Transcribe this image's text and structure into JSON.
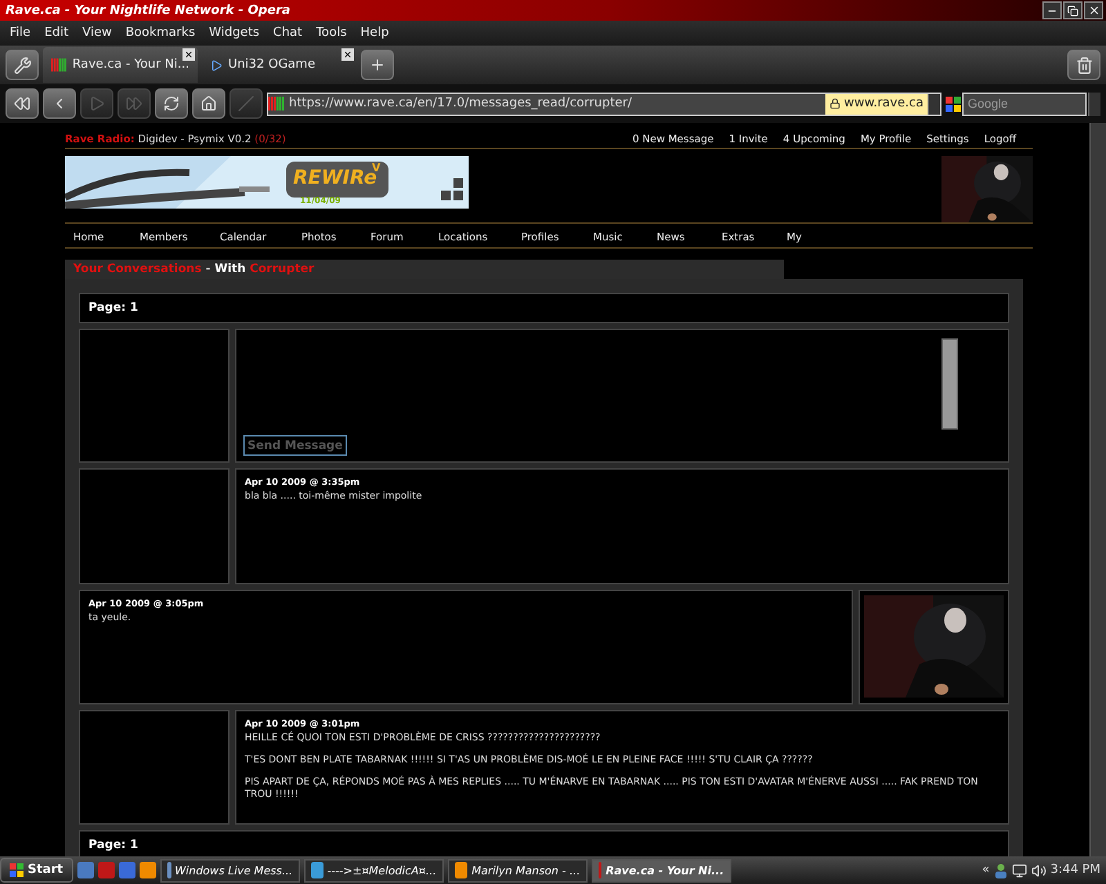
{
  "window": {
    "title": "Rave.ca - Your Nightlife Network - Opera"
  },
  "menu": [
    "File",
    "Edit",
    "View",
    "Bookmarks",
    "Widgets",
    "Chat",
    "Tools",
    "Help"
  ],
  "tabs": [
    {
      "label": "Rave.ca - Your Ni...",
      "selected": true
    },
    {
      "label": "Uni32 OGame",
      "selected": false
    }
  ],
  "nav_buttons": [
    {
      "kind": "rewind",
      "disabled": false
    },
    {
      "kind": "back",
      "disabled": false
    },
    {
      "kind": "forward",
      "disabled": true
    },
    {
      "kind": "fast_forward",
      "disabled": true
    },
    {
      "kind": "reload",
      "disabled": false
    },
    {
      "kind": "home",
      "disabled": false
    },
    {
      "kind": "edit",
      "disabled": true
    }
  ],
  "address": {
    "value": "https://www.rave.ca/en/17.0/messages_read/corrupter/",
    "site": "www.rave.ca"
  },
  "search": {
    "placeholder": "Google"
  },
  "page": {
    "radio": {
      "label": "Rave Radio:",
      "track": "Digidev - Psymix V0.2",
      "count": "(0/32)"
    },
    "user_links": [
      "0 New Message",
      "1 Invite",
      "4 Upcoming",
      "My Profile",
      "Settings",
      "Logoff"
    ],
    "banner": {
      "title": "REWIRe",
      "mark": "V",
      "date": "11/04/09"
    },
    "nav": [
      "Home",
      "Members",
      "Calendar",
      "Photos",
      "Forum",
      "Locations",
      "Profiles",
      "Music",
      "News",
      "Extras",
      "My"
    ],
    "heading": [
      {
        "text": "Your Conversations",
        "color": "#e01010"
      },
      {
        "text": "-",
        "color": "#cccccc"
      },
      {
        "text": "With",
        "color": "#ffffff"
      },
      {
        "text": "Corrupter",
        "color": "#e01010"
      }
    ],
    "pager_top": "Page: 1",
    "compose": {
      "button": "Send Message"
    },
    "messages": [
      {
        "kind": "avatar_left",
        "has_photo": false,
        "time": "Apr 10 2009 @ 3:35pm",
        "paragraphs": [
          "bla bla ..... toi-même mister impolite"
        ]
      },
      {
        "kind": "avatar_right",
        "has_photo": true,
        "time": "Apr 10 2009 @ 3:05pm",
        "paragraphs": [
          "ta yeule."
        ]
      },
      {
        "kind": "avatar_left",
        "has_photo": false,
        "time": "Apr 10 2009 @ 3:01pm",
        "paragraphs": [
          "HEILLE CÉ QUOI TON ESTI D'PROBLÈME DE CRISS ??????????????????????",
          "T'ES DONT BEN PLATE TABARNAK !!!!!! SI T'AS UN PROBLÈME DIS-MOÉ LE EN PLEINE FACE !!!!! S'TU CLAIR ÇA ??????",
          "PIS APART DE ÇA, RÉPONDS MOÉ PAS À MES REPLIES ..... TU M'ÉNARVE EN TABARNAK ..... PIS TON ESTI D'AVATAR M'ÉNERVE AUSSI ..... FAK PREND TON TROU !!!!!!"
        ]
      }
    ],
    "pager_bottom": "Page: 1"
  },
  "taskbar": {
    "start": "Start",
    "tasks": [
      {
        "label": "Windows Live Mess...",
        "selected": false,
        "color": "#6a8fc0"
      },
      {
        "label": "---->±¤MelodicA¤...",
        "selected": false,
        "color": "#3a9bd8"
      },
      {
        "label": "Marilyn Manson - ...",
        "selected": false,
        "color": "#f08a00"
      },
      {
        "label": "Rave.ca - Your Ni...",
        "selected": true,
        "color": "#c01818"
      }
    ],
    "tray_toggle": "«",
    "clock": "3:44 PM"
  }
}
